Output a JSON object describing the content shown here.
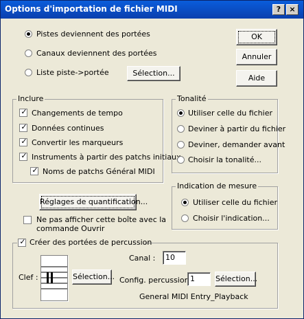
{
  "window": {
    "title": "Options d'importation de fichier MIDI",
    "help_glyph": "?",
    "close_glyph": "×"
  },
  "tracks": {
    "options": [
      {
        "label": "Pistes deviennent des portées",
        "selected": true
      },
      {
        "label": "Canaux deviennent des portées",
        "selected": false
      },
      {
        "label": "Liste piste->portée",
        "selected": false
      }
    ],
    "selection_button": "Sélection..."
  },
  "actions": {
    "ok": "OK",
    "cancel": "Annuler",
    "help": "Aide"
  },
  "include": {
    "legend": "Inclure",
    "items": [
      {
        "label": "Changements de tempo",
        "checked": true
      },
      {
        "label": "Données continues",
        "checked": true
      },
      {
        "label": "Convertir les marqueurs",
        "checked": true
      },
      {
        "label": "Instruments à partir des patchs initiaux",
        "checked": true
      },
      {
        "label": "Noms de patchs Général MIDI",
        "checked": true
      }
    ]
  },
  "key": {
    "legend": "Tonalité",
    "options": [
      {
        "label": "Utiliser celle du fichier",
        "selected": true
      },
      {
        "label": "Deviner à partir du fichier",
        "selected": false
      },
      {
        "label": "Deviner, demander avant",
        "selected": false
      },
      {
        "label": "Choisir la tonalité...",
        "selected": false
      }
    ]
  },
  "time_signature": {
    "legend": "Indication de mesure",
    "options": [
      {
        "label": "Utiliser celle du fichier",
        "selected": true
      },
      {
        "label": "Choisir l'indication...",
        "selected": false
      }
    ]
  },
  "quantization_button": "Réglages de quantification...",
  "dont_show": {
    "line1": "Ne pas afficher cette boîte avec la",
    "line2": "commande Ouvrir",
    "checked": false
  },
  "percussion": {
    "legend": "Créer des portées de percussion",
    "checked": true,
    "clef_label": "Clef :",
    "clef_button": "Sélection...",
    "channel_label": "Canal :",
    "channel_value": "10",
    "config_label": "Config. percussion :",
    "config_value": "1",
    "config_button": "Sélection...",
    "map_name": "General MIDI Entry_Playback"
  }
}
